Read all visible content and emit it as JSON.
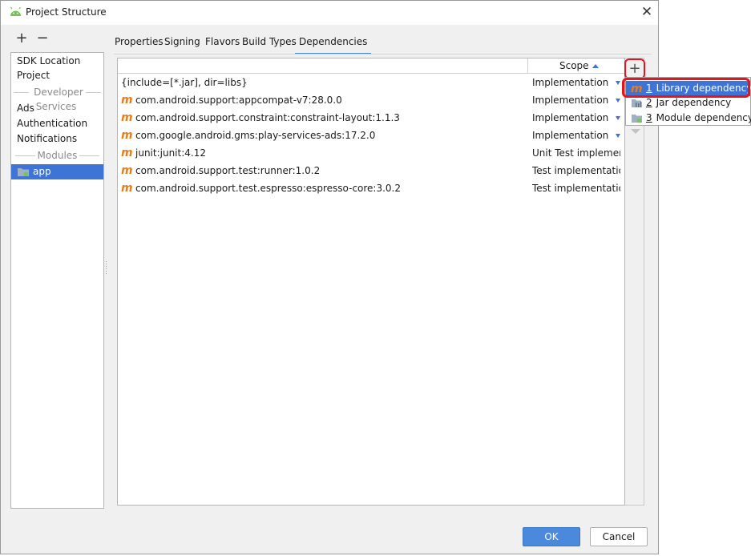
{
  "window": {
    "title": "Project Structure",
    "close_glyph": "✕",
    "icon": "android-icon"
  },
  "sidebar": {
    "add_glyph": "+",
    "remove_glyph": "−",
    "items": [
      {
        "label": "SDK Location"
      },
      {
        "label": "Project"
      },
      {
        "label": "Developer Services",
        "type": "section"
      },
      {
        "label": "Ads"
      },
      {
        "label": "Authentication"
      },
      {
        "label": "Notifications"
      },
      {
        "label": "Modules",
        "type": "section"
      },
      {
        "label": "app",
        "selected": true,
        "icon": "module-folder-icon"
      }
    ]
  },
  "tabs": [
    {
      "label": "Properties"
    },
    {
      "label": "Signing"
    },
    {
      "label": "Flavors"
    },
    {
      "label": "Build Types"
    },
    {
      "label": "Dependencies",
      "active": true
    }
  ],
  "table": {
    "scope_header": "Scope",
    "sort": "ascending",
    "rows": [
      {
        "name": "{include=[*.jar], dir=libs}",
        "scope": "Implementation",
        "icon": "none",
        "dropdown": true
      },
      {
        "name": "com.android.support:appcompat-v7:28.0.0",
        "scope": "Implementation",
        "icon": "maven-m-icon",
        "dropdown": true
      },
      {
        "name": "com.android.support.constraint:constraint-layout:1.1.3",
        "scope": "Implementation",
        "icon": "maven-m-icon",
        "dropdown": true
      },
      {
        "name": "com.google.android.gms:play-services-ads:17.2.0",
        "scope": "Implementation",
        "icon": "maven-m-icon",
        "dropdown": true
      },
      {
        "name": "junit:junit:4.12",
        "scope": "Unit Test implemen...",
        "icon": "maven-m-icon",
        "dropdown": false
      },
      {
        "name": "com.android.support.test:runner:1.0.2",
        "scope": "Test implementation",
        "icon": "maven-m-icon",
        "dropdown": false
      },
      {
        "name": "com.android.support.test.espresso:espresso-core:3.0.2",
        "scope": "Test implementation",
        "icon": "maven-m-icon",
        "dropdown": false
      }
    ]
  },
  "toolbar": {
    "add_glyph": "+"
  },
  "add_menu": {
    "items": [
      {
        "mnemonic": "1",
        "label": "Library dependency",
        "icon": "maven-m-icon",
        "selected": true
      },
      {
        "mnemonic": "2",
        "label": "Jar dependency",
        "icon": "jar-icon"
      },
      {
        "mnemonic": "3",
        "label": "Module dependency",
        "icon": "module-folder-icon"
      }
    ]
  },
  "buttons": {
    "ok": "OK",
    "cancel": "Cancel"
  },
  "colors": {
    "selection": "#3d74d6",
    "highlight_annotation": "#e8141c",
    "maven_orange": "#e87d1e",
    "android_green": "#78c257",
    "ok_button": "#4a89dc"
  }
}
